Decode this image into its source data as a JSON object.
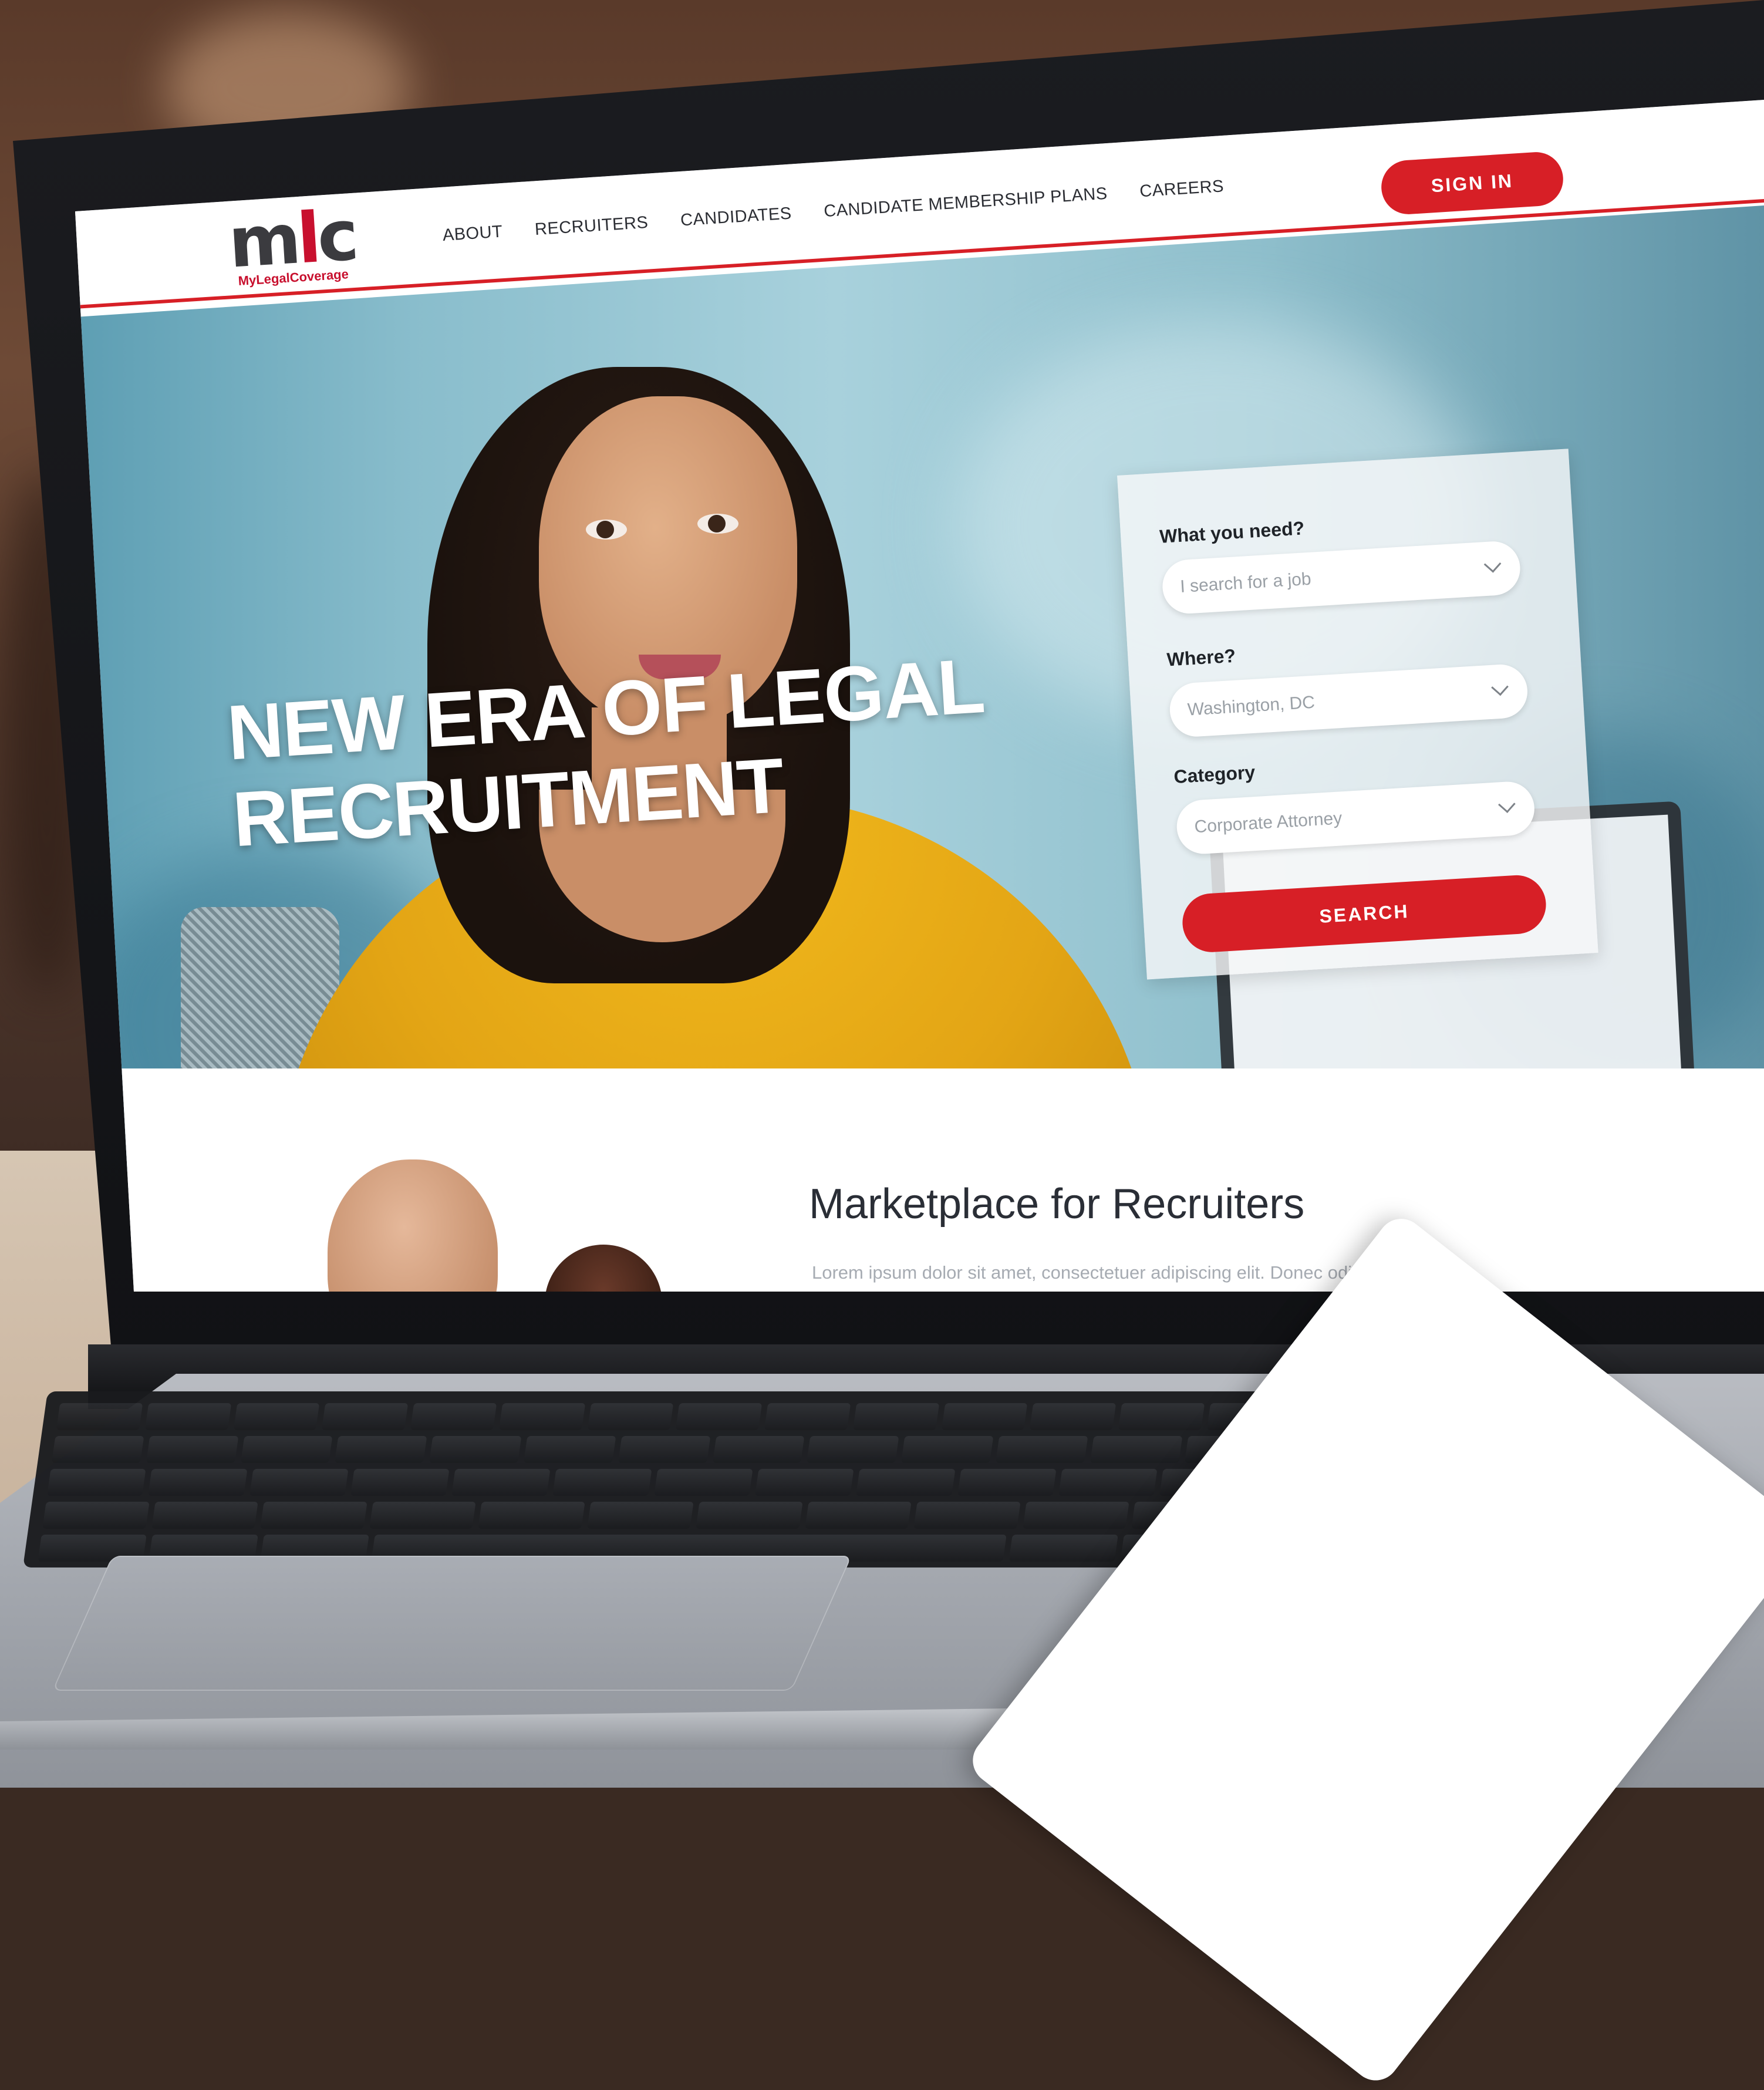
{
  "site": {
    "logo_mark_left": "m",
    "logo_mark_red": "l",
    "logo_mark_right": "c",
    "logo_sub": "MyLegalCoverage"
  },
  "nav": {
    "items": [
      {
        "label": "ABOUT"
      },
      {
        "label": "RECRUITERS"
      },
      {
        "label": "CANDIDATES"
      },
      {
        "label": "CANDIDATE MEMBERSHIP PLANS"
      },
      {
        "label": "CAREERS"
      }
    ],
    "sign_in_label": "SIGN IN"
  },
  "hero": {
    "title_line1": "NEW ERA OF LEGAL",
    "title_line2": "RECRUITMENT"
  },
  "search_form": {
    "need_label": "What you need?",
    "need_value": "I search for a job",
    "where_label": "Where?",
    "where_value": "Washington, DC",
    "category_label": "Category",
    "category_value": "Corporate Attorney",
    "search_label": "SEARCH"
  },
  "section": {
    "title": "Marketplace for Recruiters",
    "body": "Lorem ipsum dolor sit amet, consectetuer adipiscing elit. Donec odio. Quisque"
  },
  "colors": {
    "accent": "#d71f26",
    "logo_gray": "#3b3b3f",
    "nav_text": "#2b2d33"
  }
}
